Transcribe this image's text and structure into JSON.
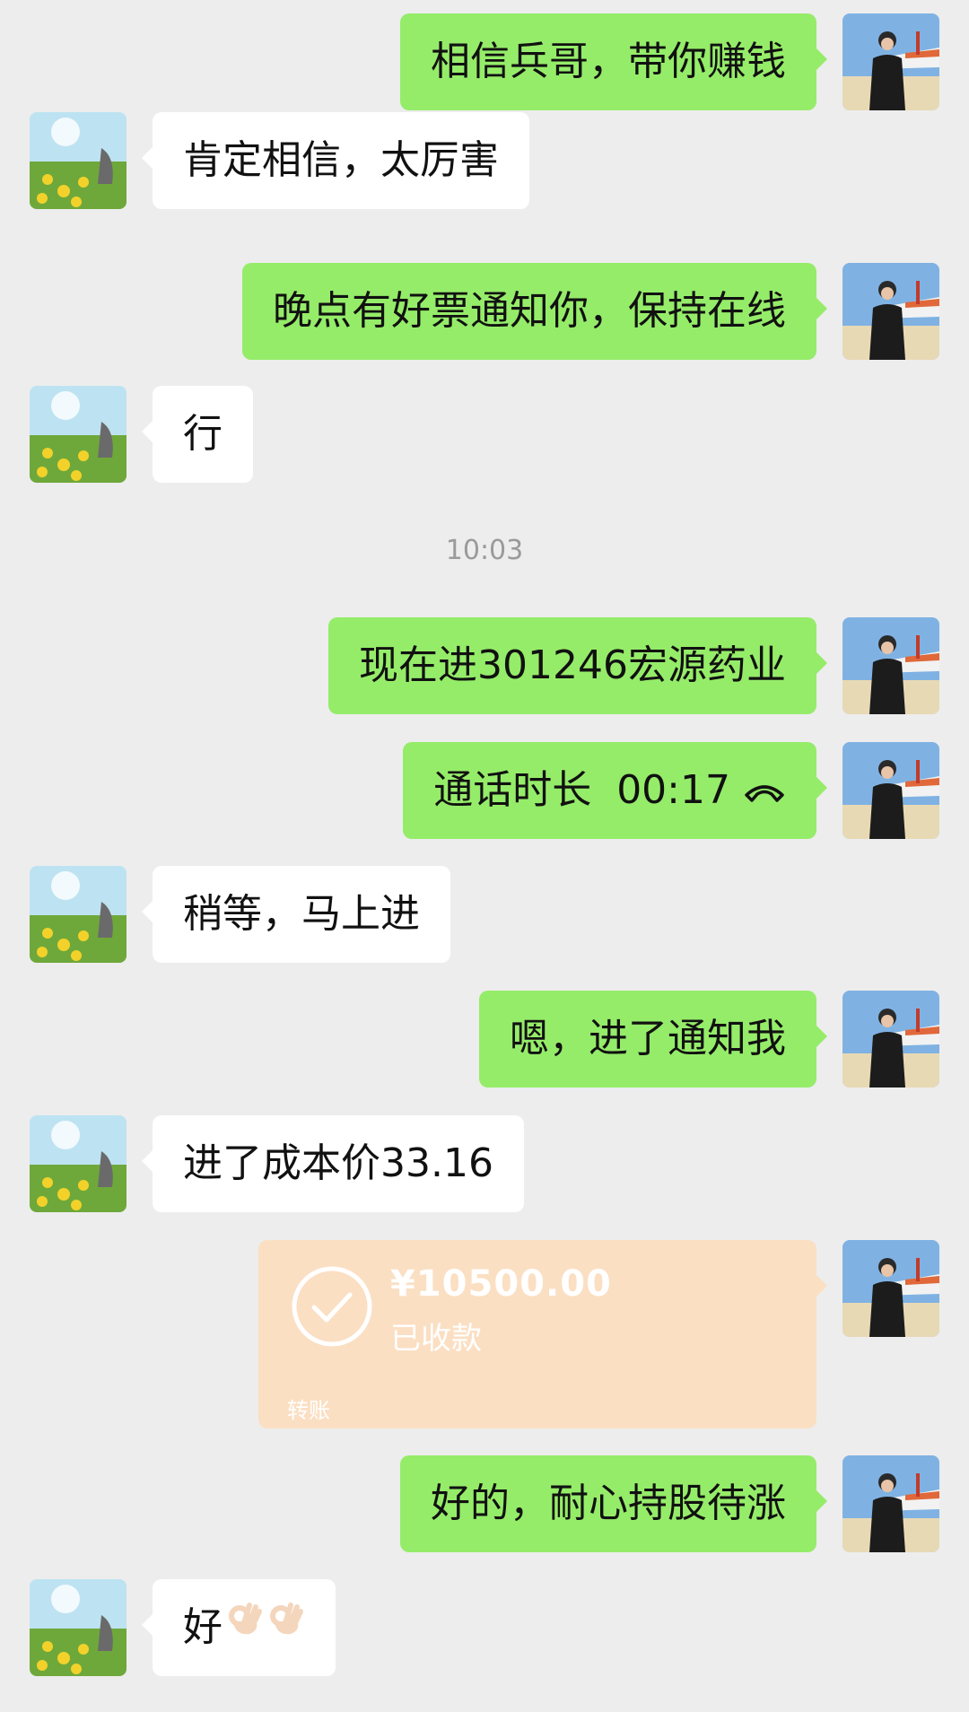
{
  "messages": [
    {
      "from": "me",
      "text": "相信兵哥，带你赚钱"
    },
    {
      "from": "them",
      "text": "肯定相信，太厉害"
    },
    {
      "from": "me",
      "text": "晚点有好票通知你，保持在线"
    },
    {
      "from": "them",
      "text": "行"
    },
    {
      "timestamp": "10:03"
    },
    {
      "from": "me",
      "text": "现在进301246宏源药业"
    },
    {
      "from": "me",
      "text": "通话时长  00:17",
      "icon": "phone-hangup-icon"
    },
    {
      "from": "them",
      "text": "稍等，马上进"
    },
    {
      "from": "me",
      "text": "嗯，进了通知我"
    },
    {
      "from": "them",
      "text": "进了成本价33.16"
    },
    {
      "from": "me",
      "transfer": {
        "amount": "¥10500.00",
        "status": "已收款",
        "label": "转账"
      }
    },
    {
      "from": "me",
      "text": "好的，耐心持股待涨"
    },
    {
      "from": "them",
      "text": "好",
      "emojis": [
        "ok-hand-icon",
        "ok-hand-icon"
      ]
    }
  ],
  "colors": {
    "background": "#ededed",
    "outgoing_bubble": "#95ec69",
    "incoming_bubble": "#ffffff",
    "transfer_card": "#fbdfc3"
  }
}
